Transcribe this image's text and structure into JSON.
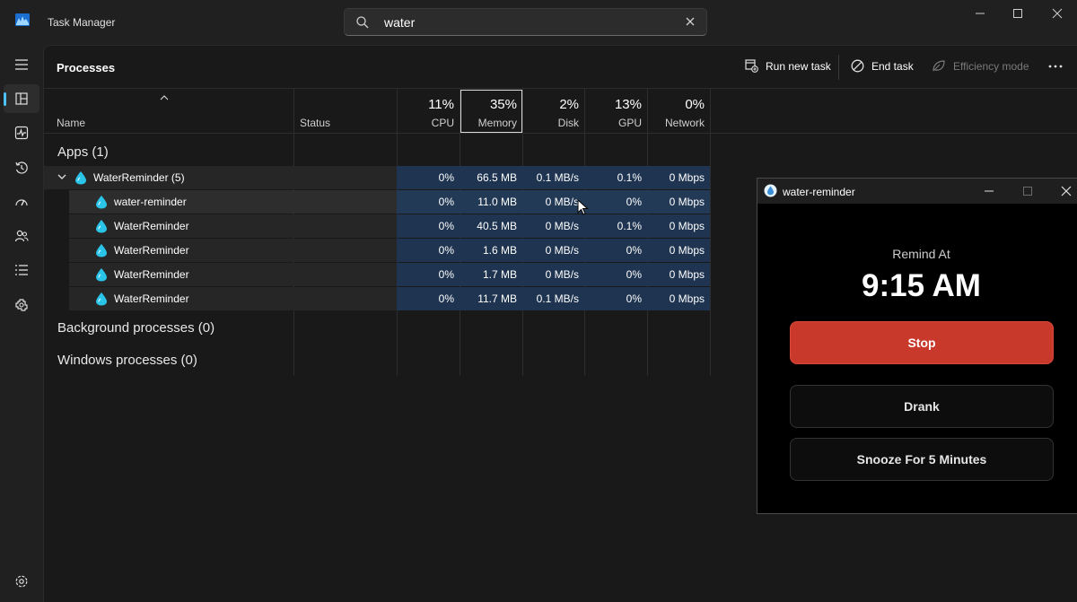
{
  "window": {
    "title": "Task Manager"
  },
  "search": {
    "value": "water"
  },
  "commandbar": {
    "page_title": "Processes",
    "run_new_task": "Run new task",
    "end_task": "End task",
    "efficiency_mode": "Efficiency mode"
  },
  "columns": {
    "name": "Name",
    "status": "Status",
    "cpu": {
      "pct": "11%",
      "label": "CPU"
    },
    "memory": {
      "pct": "35%",
      "label": "Memory"
    },
    "disk": {
      "pct": "2%",
      "label": "Disk"
    },
    "gpu": {
      "pct": "13%",
      "label": "GPU"
    },
    "network": {
      "pct": "0%",
      "label": "Network"
    }
  },
  "groups": {
    "apps": "Apps (1)",
    "background": "Background processes (0)",
    "windows": "Windows processes (0)"
  },
  "rows": [
    {
      "name": "WaterReminder (5)",
      "cpu": "0%",
      "memory": "66.5 MB",
      "disk": "0.1 MB/s",
      "gpu": "0.1%",
      "network": "0 Mbps"
    },
    {
      "name": "water-reminder",
      "cpu": "0%",
      "memory": "11.0 MB",
      "disk": "0 MB/s",
      "gpu": "0%",
      "network": "0 Mbps"
    },
    {
      "name": "WaterReminder",
      "cpu": "0%",
      "memory": "40.5 MB",
      "disk": "0 MB/s",
      "gpu": "0.1%",
      "network": "0 Mbps"
    },
    {
      "name": "WaterReminder",
      "cpu": "0%",
      "memory": "1.6 MB",
      "disk": "0 MB/s",
      "gpu": "0%",
      "network": "0 Mbps"
    },
    {
      "name": "WaterReminder",
      "cpu": "0%",
      "memory": "1.7 MB",
      "disk": "0 MB/s",
      "gpu": "0%",
      "network": "0 Mbps"
    },
    {
      "name": "WaterReminder",
      "cpu": "0%",
      "memory": "11.7 MB",
      "disk": "0.1 MB/s",
      "gpu": "0%",
      "network": "0 Mbps"
    }
  ],
  "popup": {
    "title": "water-reminder",
    "remind_label": "Remind At",
    "time": "9:15 AM",
    "stop": "Stop",
    "drank": "Drank",
    "snooze": "Snooze For 5 Minutes"
  },
  "colors": {
    "accent": "#4cc2ff",
    "highlight": "#1e3450",
    "stop": "#c8392b",
    "drop": "#29c4e8"
  },
  "icons": [
    "task-manager-logo-icon",
    "search-icon",
    "close-icon",
    "hamburger-icon",
    "processes-icon",
    "performance-icon",
    "app-history-icon",
    "startup-icon",
    "users-icon",
    "details-icon",
    "services-icon",
    "settings-icon",
    "run-task-icon",
    "end-task-icon",
    "efficiency-icon",
    "more-icon",
    "water-drop-icon"
  ]
}
